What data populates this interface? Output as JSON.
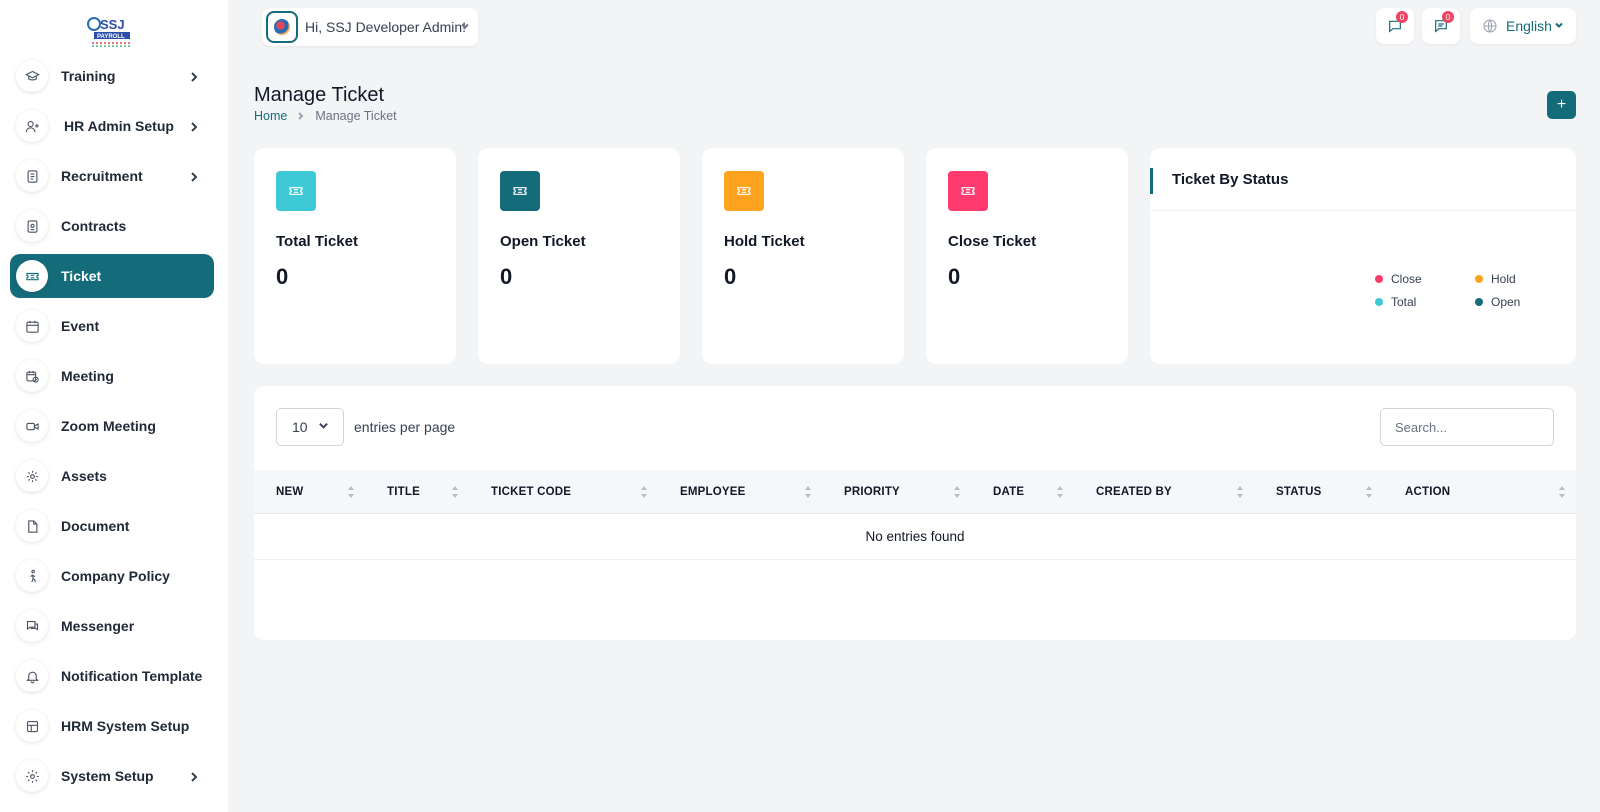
{
  "app": {
    "logo_alt": "SSJ PAYROLL"
  },
  "sidebar": {
    "items": [
      {
        "label": "Training",
        "icon": "graduation-cap-icon",
        "has_children": true
      },
      {
        "label": "HR Admin Setup",
        "icon": "user-plus-icon",
        "has_children": true
      },
      {
        "label": "Recruitment",
        "icon": "clipboard-icon",
        "has_children": true
      },
      {
        "label": "Contracts",
        "icon": "contract-icon",
        "has_children": false
      },
      {
        "label": "Ticket",
        "icon": "ticket-icon",
        "has_children": false,
        "active": true
      },
      {
        "label": "Event",
        "icon": "calendar-icon",
        "has_children": false
      },
      {
        "label": "Meeting",
        "icon": "calendar-clock-icon",
        "has_children": false
      },
      {
        "label": "Zoom Meeting",
        "icon": "video-icon",
        "has_children": false
      },
      {
        "label": "Assets",
        "icon": "asset-icon",
        "has_children": false
      },
      {
        "label": "Document",
        "icon": "file-icon",
        "has_children": false
      },
      {
        "label": "Company Policy",
        "icon": "walk-icon",
        "has_children": false
      },
      {
        "label": "Messenger",
        "icon": "message-icon",
        "has_children": false
      },
      {
        "label": "Notification Template",
        "icon": "bell-icon",
        "has_children": false
      },
      {
        "label": "HRM System Setup",
        "icon": "table-icon",
        "has_children": false
      },
      {
        "label": "System Setup",
        "icon": "gear-icon",
        "has_children": true
      }
    ]
  },
  "header": {
    "greeting": "Hi, SSJ Developer Admin!",
    "messages_badge": "0",
    "chat_badge": "0",
    "language": "English"
  },
  "page": {
    "title": "Manage Ticket",
    "breadcrumb": {
      "home": "Home",
      "current": "Manage Ticket"
    },
    "add_label": "+"
  },
  "stats": [
    {
      "label": "Total Ticket",
      "value": "0",
      "color": "#3ec9d6"
    },
    {
      "label": "Open Ticket",
      "value": "0",
      "color": "#146b7a"
    },
    {
      "label": "Hold Ticket",
      "value": "0",
      "color": "#ffa21d"
    },
    {
      "label": "Close Ticket",
      "value": "0",
      "color": "#ff3a6e"
    }
  ],
  "status_chart": {
    "title": "Ticket By Status",
    "legend": [
      {
        "label": "Close",
        "color": "#ff3a6e"
      },
      {
        "label": "Hold",
        "color": "#ffa21d"
      },
      {
        "label": "Total",
        "color": "#3ec9d6"
      },
      {
        "label": "Open",
        "color": "#146b7a"
      }
    ]
  },
  "table": {
    "entries_value": "10",
    "entries_label": "entries per page",
    "search_placeholder": "Search...",
    "columns": [
      "NEW",
      "TITLE",
      "TICKET CODE",
      "EMPLOYEE",
      "PRIORITY",
      "DATE",
      "CREATED BY",
      "STATUS",
      "ACTION"
    ],
    "empty_text": "No entries found"
  }
}
